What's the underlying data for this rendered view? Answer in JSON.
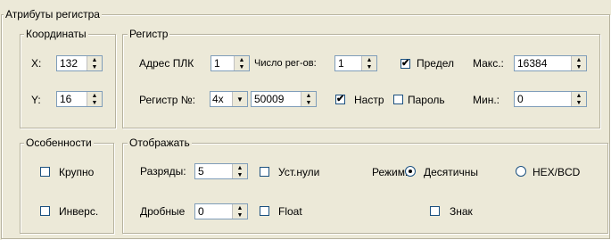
{
  "group_main": {
    "title": "Атрибуты регистра"
  },
  "coords": {
    "title": "Координаты",
    "x_label": "X:",
    "x_value": "132",
    "y_label": "Y:",
    "y_value": "16"
  },
  "register": {
    "title": "Регистр",
    "plc_address_label": "Адрес ПЛК",
    "plc_address_value": "1",
    "reg_count_label": "Число рег-ов:",
    "reg_count_value": "1",
    "limit_label": "Предел",
    "limit_checked": true,
    "max_label": "Макс.:",
    "max_value": "16384",
    "reg_no_label": "Регистр №:",
    "reg_type_value": "4x",
    "reg_no_value": "50009",
    "setup_label": "Настр",
    "setup_checked": true,
    "password_label": "Пароль",
    "password_checked": false,
    "min_label": "Мин.:",
    "min_value": "0"
  },
  "features": {
    "title": "Особенности",
    "large_label": "Крупно",
    "large_checked": false,
    "inverse_label": "Инверс.",
    "inverse_checked": false
  },
  "display": {
    "title": "Отображать",
    "digits_label": "Разряды:",
    "digits_value": "5",
    "leading_zeros_label": "Уст.нули",
    "leading_zeros_checked": false,
    "mode_label": "Режим:",
    "decimal_label": "Десятичны",
    "decimal_selected": true,
    "hex_label": "HEX/BCD",
    "hex_selected": false,
    "fraction_label": "Дробные",
    "fraction_value": "0",
    "float_label": "Float",
    "float_checked": false,
    "sign_label": "Знак",
    "sign_checked": false
  },
  "icons": {
    "check": "✔",
    "spin_up": "▲",
    "spin_down": "▼",
    "combo": "▼"
  }
}
